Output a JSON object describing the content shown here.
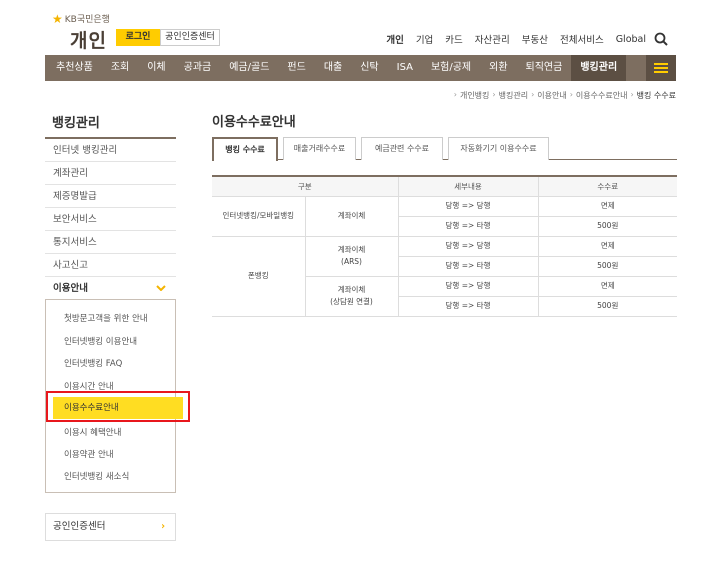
{
  "header": {
    "brand_small": "KB국민은행",
    "brand_title": "개인",
    "login_label": "로그인",
    "cert_label": "공인인증센터",
    "top_nav": [
      "개인",
      "기업",
      "카드",
      "자산관리",
      "부동산",
      "전체서비스",
      "Global"
    ]
  },
  "main_nav": [
    "추천상품",
    "조회",
    "이체",
    "공과금",
    "예금/골드",
    "펀드",
    "대출",
    "신탁",
    "ISA",
    "보험/공제",
    "외환",
    "퇴직연금",
    "뱅킹관리"
  ],
  "breadcrumb": [
    "개인뱅킹",
    "뱅킹관리",
    "이용안내",
    "이용수수료안내",
    "뱅킹 수수료"
  ],
  "sidebar": {
    "title": "뱅킹관리",
    "items": [
      "인터넷 뱅킹관리",
      "계좌관리",
      "제증명발급",
      "보안서비스",
      "통지서비스",
      "사고신고",
      "이용안내"
    ],
    "sub_items": [
      "첫방문고객을 위한 안내",
      "인터넷뱅킹 이용안내",
      "인터넷뱅킹 FAQ",
      "이용시간 안내",
      "이용수수료안내",
      "이용시 혜택안내",
      "이용약관 안내",
      "인터넷뱅킹 새소식"
    ],
    "cert_center": "공인인증센터"
  },
  "content": {
    "title": "이용수수료안내",
    "tabs": [
      "뱅킹 수수료",
      "매출거래수수료",
      "예금관련 수수료",
      "자동화기기 이용수수료"
    ],
    "table": {
      "headers": [
        "구분",
        "세부내용",
        "수수료"
      ],
      "group1": "인터넷뱅킹/모바일뱅킹",
      "transfer": "계좌이체",
      "group2": "폰뱅킹",
      "ars_line1": "계좌이체",
      "ars_line2": "(ARS)",
      "agent_line1": "계좌이체",
      "agent_line2": "(상담원 연결)",
      "same_bank": "당행 => 당행",
      "other_bank": "당행 => 타행",
      "free": "면제",
      "fee": "500원"
    }
  },
  "colors": {
    "brand_brown": "#7d6e60",
    "brand_yellow": "#ffcc00",
    "highlight_red": "#e8171c"
  }
}
